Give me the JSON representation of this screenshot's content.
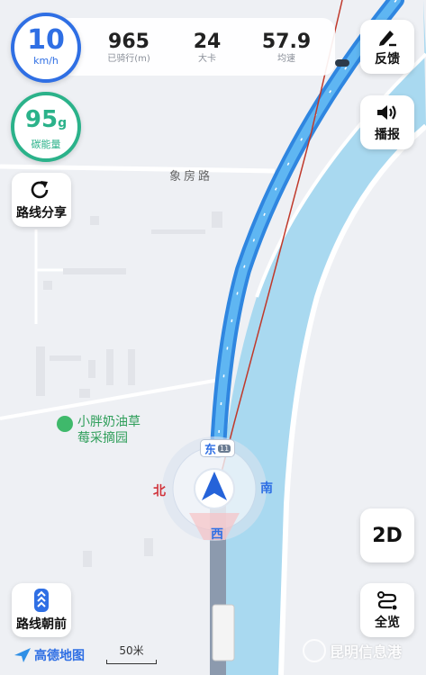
{
  "speed": {
    "value": "10",
    "unit": "km/h"
  },
  "stats": [
    {
      "value": "965",
      "label": "已骑行(m)"
    },
    {
      "value": "24",
      "label": "大卡"
    },
    {
      "value": "57.9",
      "label": "均速"
    }
  ],
  "carbon": {
    "value": "95",
    "unit": "g",
    "label": "碳能量"
  },
  "buttons": {
    "feedback": "反馈",
    "broadcast": "播报",
    "share_route": "路线分享",
    "mode_2d": "2D",
    "overview": "全览",
    "route_heading": "路线朝前"
  },
  "map": {
    "road_name": "象房路",
    "poi_name_line1": "小胖奶油草",
    "poi_name_line2": "莓采摘园",
    "compass": {
      "north": "北",
      "south": "南",
      "east": "东",
      "west": "西"
    },
    "road_badge": "11"
  },
  "footer": {
    "brand": "高德地图",
    "scale": "50米",
    "watermark": "昆明信息港"
  },
  "colors": {
    "accent": "#2f6fe4",
    "route": "#4aa3ea",
    "carbon": "#2bb28a",
    "river": "#a9d9f0"
  }
}
